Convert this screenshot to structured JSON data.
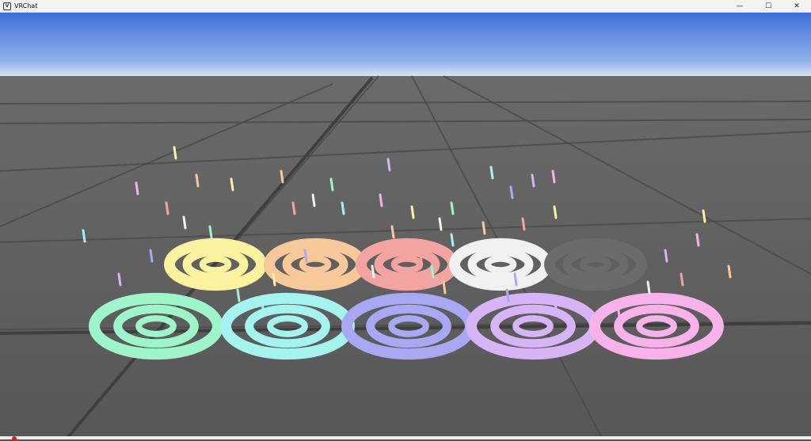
{
  "window": {
    "title": "VRChat",
    "icon": "vrchat-app-icon",
    "controls": {
      "minimize_glyph": "—",
      "maximize_glyph": "☐",
      "close_glyph": "✕"
    }
  },
  "scene": {
    "sky_top_color": "#3f6fdc",
    "sky_horizon_color": "#c9dbf3",
    "floor_color": "#5c5c5c",
    "grid_color": "#4a4a4a",
    "back_row_colors": [
      "#fbf2a0",
      "#f7c89a",
      "#f3a3a0",
      "#f0f0f0",
      "#6b6b6b"
    ],
    "front_row_colors": [
      "#9ef5c9",
      "#a4f3ee",
      "#a9a9f3",
      "#d7b4f6",
      "#f6b2e9"
    ]
  }
}
